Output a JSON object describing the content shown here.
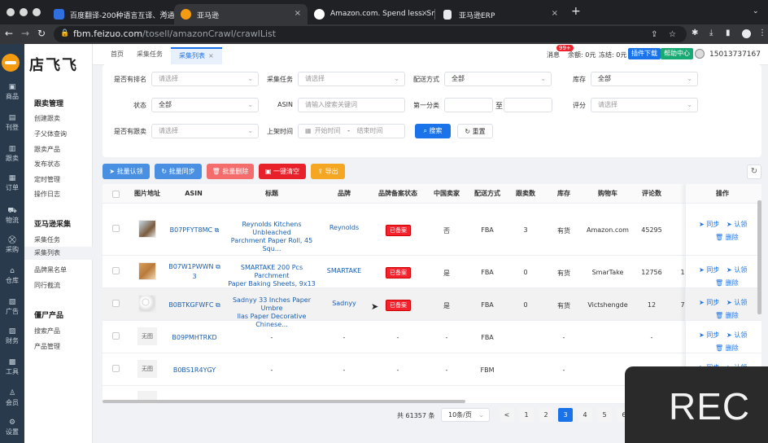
{
  "browser": {
    "tabs": [
      {
        "title": "百度翻译-200种语言互译、沟通",
        "icon": "baidu-translate-icon",
        "active": false
      },
      {
        "title": "亚马逊",
        "icon": "feizuo-icon",
        "active": true
      },
      {
        "title": "Amazon.com. Spend less. Smi",
        "icon": "amazon-icon",
        "active": false
      },
      {
        "title": "亚马逊ERP",
        "icon": "erp-icon",
        "active": false
      }
    ],
    "url_host": "fbm.feizuo.com",
    "url_path": "/tosell/amazonCrawl/crawlList"
  },
  "rail": [
    {
      "label": "商品",
      "icon": "goods-icon"
    },
    {
      "label": "刊登",
      "icon": "listing-icon"
    },
    {
      "label": "跟卖",
      "icon": "follow-sell-icon"
    },
    {
      "label": "订单",
      "icon": "order-icon"
    },
    {
      "label": "物流",
      "icon": "truck-icon"
    },
    {
      "label": "采购",
      "icon": "cart-icon"
    },
    {
      "label": "仓库",
      "icon": "warehouse-icon"
    },
    {
      "label": "广告",
      "icon": "ad-icon"
    },
    {
      "label": "财务",
      "icon": "finance-icon"
    },
    {
      "label": "工具",
      "icon": "tools-icon"
    },
    {
      "label": "会员",
      "icon": "member-icon"
    },
    {
      "label": "设置",
      "icon": "settings-icon"
    }
  ],
  "brand": "店飞飞",
  "nav": {
    "groups": [
      {
        "title": "跟卖管理",
        "items": [
          "创建跟卖",
          "子父体查询",
          "跟卖产品",
          "发布状态",
          "定时管理",
          "操作日志"
        ]
      },
      {
        "title": "亚马逊采集",
        "items": [
          "采集任务",
          "采集列表",
          "品牌黑名单",
          "同行截流"
        ]
      },
      {
        "title": "僵尸产品",
        "items": [
          "搜索产品",
          "产品管理"
        ]
      }
    ],
    "active": "采集列表"
  },
  "topbar": {
    "tabs": [
      {
        "label": "首页"
      },
      {
        "label": "采集任务"
      },
      {
        "label": "采集列表",
        "closable": "×"
      }
    ],
    "msg_label": "消息",
    "msg_badge": "99+",
    "balance": "余额: 0元",
    "frozen": "冻结: 0元",
    "download_btn": "插件下载",
    "help_btn": "帮助中心",
    "phone": "15013737167"
  },
  "filters": {
    "ranked_label": "是否有排名",
    "ranked_ph": "请选择",
    "task_label": "采集任务",
    "task_ph": "请选择",
    "ship_label": "配送方式",
    "ship_val": "全部",
    "stock_label": "库存",
    "stock_val": "全部",
    "status_label": "状态",
    "status_val": "全部",
    "asin_label": "ASIN",
    "asin_ph": "请输入搜索关键词",
    "cat_label": "第一分类",
    "cat_to": "至",
    "score_label": "评分",
    "score_ph": "请选择",
    "follow_label": "是否有跟卖",
    "follow_ph": "请选择",
    "date_label": "上架时间",
    "date_start": "开始时间",
    "date_sep": "-",
    "date_end": "结束时间",
    "search_btn": "搜索",
    "reset_btn": "重置"
  },
  "toolbar": {
    "claim": "批量认领",
    "sync": "批量同步",
    "delete": "批量删除",
    "clear": "一键清空",
    "export": "导出"
  },
  "colors": {
    "primary": "#1a73e8",
    "toolbar_blue": "#4a90e2",
    "danger": "#f5222d",
    "delete_btn": "#f56c6c",
    "warn": "#f5a623",
    "rail": "#293a4c"
  },
  "table": {
    "headers": [
      "图片地址",
      "ASIN",
      "标题",
      "品牌",
      "品牌备案状态",
      "中国卖家",
      "配送方式",
      "跟卖数",
      "库存",
      "购物车",
      "评论数",
      "操作"
    ],
    "rows": [
      {
        "img": "",
        "asin": "B07PFYT8MC",
        "title1": "Reynolds Kitchens Unbleached",
        "title2": "Parchment Paper Roll, 45 Squ...",
        "brand": "Reynolds",
        "reg": "已备案",
        "cn": "否",
        "ship": "FBA",
        "follow": "3",
        "stock": "有货",
        "cart": "Amazon.com",
        "reviews": "45295",
        "extra": ""
      },
      {
        "img": "",
        "asin": "B07W1PWWN",
        "asin2": "3",
        "title1": "SMARTAKE 200 Pcs Parchment",
        "title2": "Paper Baking Sheets, 9x13 In...",
        "brand": "SMARTAKE",
        "reg": "已备案",
        "cn": "是",
        "ship": "FBA",
        "follow": "0",
        "stock": "有货",
        "cart": "SmarTake",
        "reviews": "12756",
        "extra": "1"
      },
      {
        "img": "",
        "asin": "B0BTKGFWFC",
        "title1": "Sadnyy 33 Inches Paper Umbre",
        "title2": "llas Paper Decorative Chinese...",
        "brand": "Sadnyy",
        "reg": "已备案",
        "cn": "是",
        "ship": "FBA",
        "follow": "0",
        "stock": "有货",
        "cart": "Victshengde",
        "reviews": "12",
        "extra": "7"
      },
      {
        "img": "无图",
        "asin": "B09PMHTRKD",
        "title1": "-",
        "title2": "",
        "brand": "-",
        "reg": "-",
        "cn": "-",
        "ship": "FBA",
        "follow": "",
        "stock": "-",
        "cart": "",
        "reviews": "-",
        "extra": ""
      },
      {
        "img": "无图",
        "asin": "B0BS1R4YGY",
        "title1": "-",
        "title2": "",
        "brand": "-",
        "reg": "-",
        "cn": "-",
        "ship": "FBM",
        "follow": "",
        "stock": "-",
        "cart": "",
        "reviews": "",
        "extra": ""
      }
    ],
    "op_sync": "同步",
    "op_claim": "认领",
    "op_delete": "删除"
  },
  "pagination": {
    "total": "共 61357 条",
    "size": "10条/页",
    "pages": [
      "1",
      "2",
      "3",
      "4",
      "5",
      "6"
    ],
    "current": "3",
    "prev": "<"
  },
  "overlay": "REC"
}
